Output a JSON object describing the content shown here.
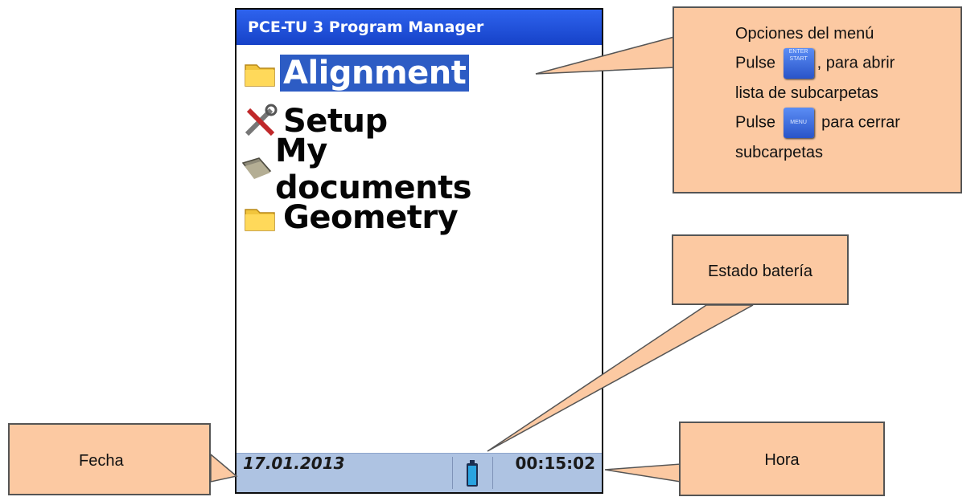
{
  "window": {
    "title": "PCE-TU 3 Program Manager"
  },
  "menu": {
    "items": [
      {
        "label": "Alignment",
        "icon": "folder-icon",
        "selected": true
      },
      {
        "label": "Setup",
        "icon": "tools-icon",
        "selected": false
      },
      {
        "label": "My documents",
        "icon": "documents-icon",
        "selected": false
      },
      {
        "label": "Geometry",
        "icon": "folder-icon",
        "selected": false
      }
    ]
  },
  "status_bar": {
    "date": "17.01.2013",
    "time": "00:15:02",
    "battery_icon": "battery-icon"
  },
  "callouts": {
    "menu_options": {
      "heading": "Opciones del menú",
      "line1_pre": "Pulse",
      "enter_key_top": "ENTER",
      "enter_key_bottom": "START",
      "line1_post": ", para abrir",
      "line2": "lista de subcarpetas",
      "line3_pre": "Pulse",
      "menu_key": "MENU",
      "line3_post": "para cerrar",
      "line4": "subcarpetas"
    },
    "battery": "Estado batería",
    "date": "Fecha",
    "time": "Hora"
  },
  "colors": {
    "title_bar": "#1f4fd8",
    "selection": "#2d5cc4",
    "status_bar": "#aec3e2",
    "callout": "#fcc9a2"
  }
}
